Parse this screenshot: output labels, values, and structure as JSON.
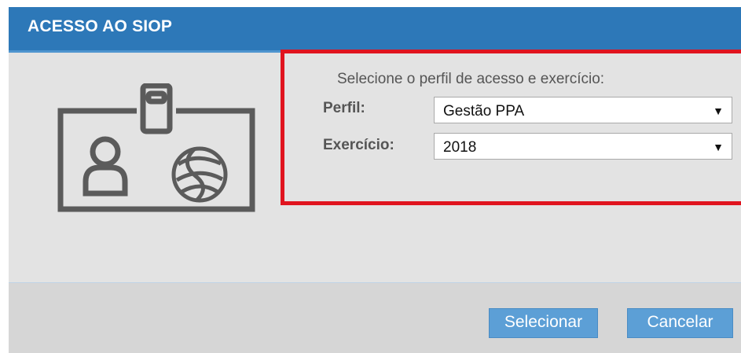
{
  "dialog": {
    "title": "ACESSO AO SIOP",
    "prompt": "Selecione o perfil de acesso e exercício:",
    "perfil": {
      "label": "Perfil:",
      "value": "Gestão PPA"
    },
    "exercicio": {
      "label": "Exercício:",
      "value": "2018"
    },
    "buttons": {
      "select_label": "Selecionar",
      "cancel_label": "Cancelar"
    },
    "icon": "id-badge-icon",
    "dropdown_icon": "▼"
  },
  "colors": {
    "titlebar": "#2d78b8",
    "highlight": "#e0141f",
    "button": "#5c9fd6"
  }
}
